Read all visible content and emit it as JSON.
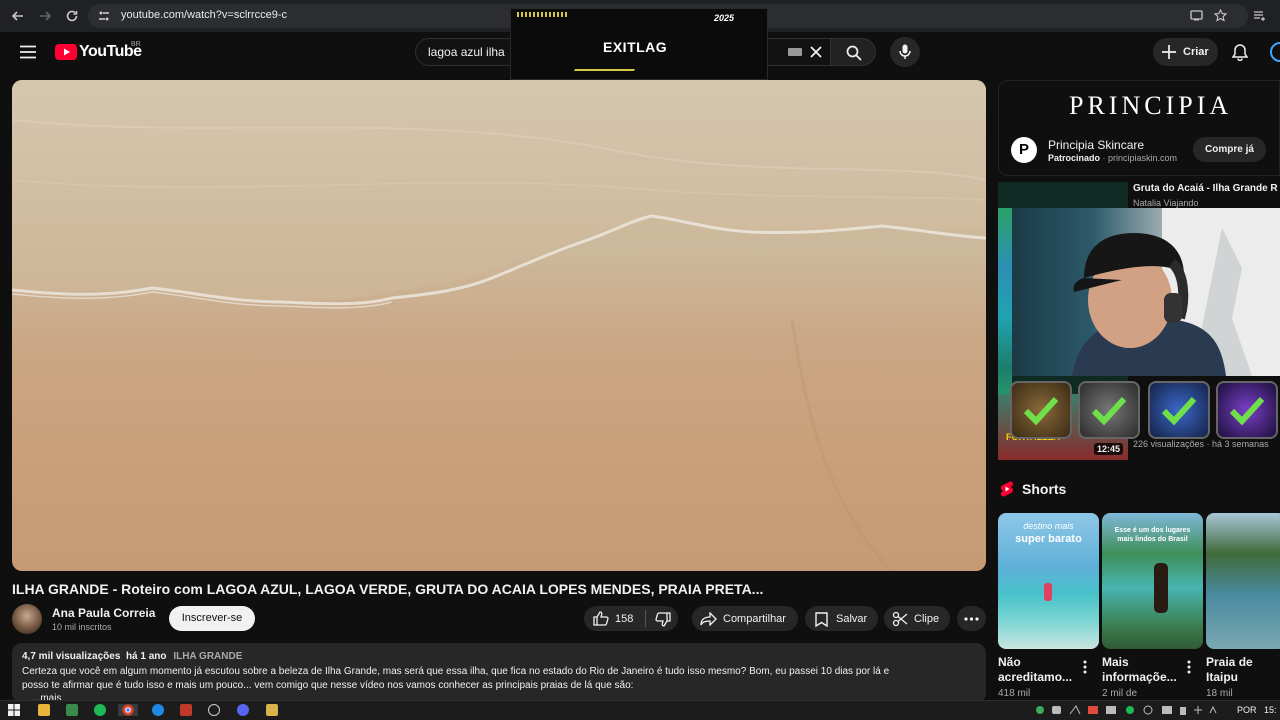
{
  "browser": {
    "url": "youtube.com/watch?v=sclrrcce9-c"
  },
  "overlay": {
    "logo": "EXITLAG",
    "badge": "2025"
  },
  "header": {
    "logo_text": "YouTube",
    "region": "BR",
    "search_value": "lagoa azul ilha",
    "create_label": "Criar"
  },
  "video": {
    "title": "ILHA GRANDE - Roteiro com LAGOA AZUL, LAGOA VERDE, GRUTA DO ACAIA LOPES MENDES, PRAIA PRETA...",
    "channel": "Ana Paula Correia",
    "subscribers": "10 mil inscritos",
    "subscribe_label": "Inscrever-se",
    "likes": "158",
    "share_label": "Compartilhar",
    "save_label": "Salvar",
    "clip_label": "Clipe"
  },
  "description": {
    "views": "4,7 mil visualizações",
    "age": "há 1 ano",
    "tag": "ILHA GRANDE",
    "line1": "Certeza que você em algum momento já escutou sobre a beleza de Ilha Grande, mas será que essa ilha, que fica no estado do Rio de Janeiro é tudo isso mesmo? Bom, eu passei 10 dias por lá e",
    "line2": "posso te afirmar que é tudo isso e mais um pouco... vem comigo que nesse vídeo nos vamos conhecer as principais praias de lá que são:",
    "more": "...mais"
  },
  "ad": {
    "brand": "PRINCIPIA",
    "icon_letter": "P",
    "title": "Principia Skincare",
    "sponsored": "Patrocinado",
    "domain": "· principiaskin.com",
    "cta": "Compre já"
  },
  "related": {
    "title": "Gruta do Acaiá - Ilha Grande R",
    "channel": "Natalia Viajando",
    "meta": "226 visualizações · há 3 semanas",
    "duration": "12:45",
    "thumb_text": "FORTALEZA"
  },
  "shorts": {
    "heading": "Shorts",
    "items": [
      {
        "title1": "Não",
        "title2": "acreditamo...",
        "views": "418 mil",
        "caption1": "destino mais",
        "caption2": "super barato"
      },
      {
        "title1": "Mais",
        "title2": "informaçõe...",
        "views": "2 mil de",
        "caption1": "Esse é um dos lugares",
        "caption2": "mais lindos do Brasil"
      },
      {
        "title1": "Praia de",
        "title2": "Itaipu",
        "views": "18 mil",
        "caption1": "",
        "caption2": ""
      }
    ]
  },
  "taskbar": {
    "lang": "POR",
    "time": "15:"
  },
  "colors": {
    "yt_red": "#ff0033",
    "background": "#0f0f0f",
    "chip": "#272727",
    "sand": "#caa684"
  }
}
